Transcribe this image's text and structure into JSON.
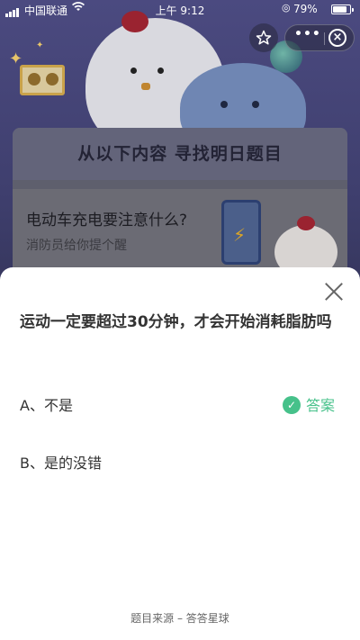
{
  "status_bar": {
    "carrier": "中国联通",
    "time": "上午 9:12",
    "battery": "79%"
  },
  "background": {
    "card_heading": "从以下内容 寻找明日题目",
    "question_title": "电动车充电要注意什么?",
    "question_subtitle": "消防员给你提个醒"
  },
  "toolbar": {
    "favorite_icon": "star-icon",
    "more_label": "•••",
    "close_icon": "close-circle-icon"
  },
  "sheet": {
    "question": "运动一定要超过30分钟，才会开始消耗脂肪吗",
    "options": [
      {
        "label": "A、不是"
      },
      {
        "label": "B、是的没错"
      }
    ],
    "answer_label": "答案",
    "answer_color": "#46c18a",
    "source": "题目来源 – 答答星球"
  }
}
